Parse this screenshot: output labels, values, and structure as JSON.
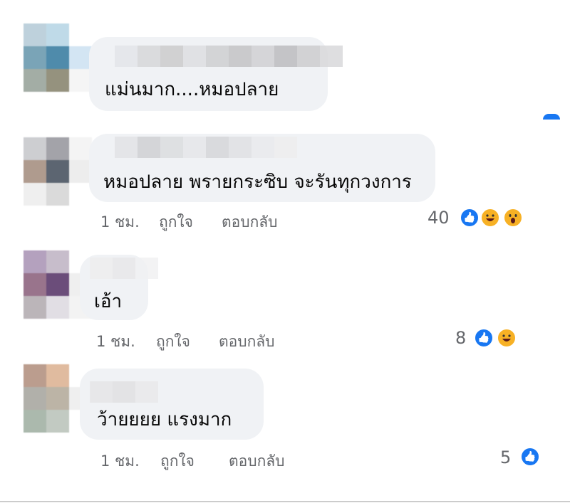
{
  "comments": [
    {
      "text": "แม่นมาก....หมอปลาย",
      "avatar_colors": [
        "#b8cdd9",
        "#b9d7e6",
        "#ffffff",
        "#6c9bb0",
        "#3c7fa3",
        "#cfe3f2",
        "#9aa59c",
        "#8a8771",
        "#f4f4f4"
      ],
      "name_colors": [
        "#e4e6ea",
        "#d7d7d9",
        "#cccccc",
        "#dedfe2",
        "#cfcfd1",
        "#c4c4c6",
        "#d1d1d3",
        "#bdbdbf",
        "#cdcdcf",
        "#d9d9db"
      ]
    },
    {
      "text": "หมอปลาย พรายกระซิบ จะรันทุกวงการ",
      "time": "1 ชม.",
      "like_label": "ถูกใจ",
      "reply_label": "ตอบกลับ",
      "reaction_count": "40",
      "reactions": [
        "like-icon",
        "haha-icon",
        "wow-icon"
      ],
      "avatar_colors": [
        "#c8c9cd",
        "#9a9aa0",
        "#f3f3f3",
        "#a79182",
        "#4b5562",
        "#ececec",
        "#eeeeee",
        "#d6d6d6",
        "#ffffff"
      ],
      "name_colors": [
        "#e2e3e6",
        "#d0d1d4",
        "#dcdddf",
        "#e6e7ea",
        "#d5d6d9",
        "#e0e1e4",
        "#e9eaed",
        "#eeeeee"
      ]
    },
    {
      "text": "เอ้า",
      "time": "1 ชม.",
      "like_label": "ถูกใจ",
      "reply_label": "ตอบกลับ",
      "reaction_count": "8",
      "reactions": [
        "like-icon",
        "haha-icon"
      ],
      "avatar_colors": [
        "#ac97b8",
        "#c2b6c6",
        "#ffffff",
        "#8e6580",
        "#5c3a6c",
        "#eeeeee",
        "#b4adb2",
        "#dedbe2",
        "#f2f2f2"
      ],
      "name_colors": [
        "#eeeeef",
        "#e8e8ea",
        "#f1f1f3"
      ]
    },
    {
      "text": "ว้ายยยย แรงมาก",
      "time": "1 ชม.",
      "like_label": "ถูกใจ",
      "reply_label": "ตอบกลับ",
      "reaction_count": "5",
      "reactions": [
        "like-icon"
      ],
      "avatar_colors": [
        "#b49382",
        "#ddb495",
        "#ffffff",
        "#a9a8a1",
        "#b5ac9d",
        "#eeeeee",
        "#a2b2a5",
        "#bcc5bc",
        "#ffffff"
      ],
      "name_colors": [
        "#e6e6e7",
        "#e1e1e3",
        "#e9e9eb"
      ]
    }
  ],
  "colors": {
    "bubble": "#f0f2f5",
    "text": "#050505",
    "meta": "#65676b",
    "like_blue": "#1877f2",
    "emoji_yellow": "#f7b125"
  }
}
